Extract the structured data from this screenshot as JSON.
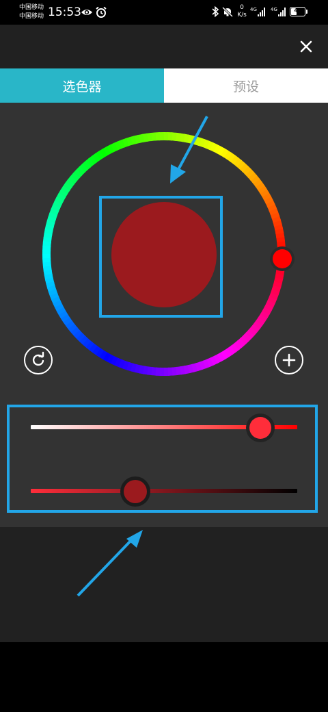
{
  "status_bar": {
    "carrier_1": "中国移动",
    "carrier_2": "中国移动",
    "time": "15:53",
    "speed_value": "0",
    "speed_unit": "K/s",
    "network_1": "4G",
    "network_2": "4G",
    "battery": "47",
    "icons": [
      "eye-icon",
      "alarm-icon",
      "bluetooth-icon",
      "mute-bell-icon",
      "signal-icon",
      "signal-icon",
      "battery-icon"
    ]
  },
  "header": {
    "close_icon": "close-icon"
  },
  "tabs": [
    {
      "label": "选色器",
      "active": true
    },
    {
      "label": "预设",
      "active": false
    }
  ],
  "color_picker": {
    "selected_color": "#9b1a1e",
    "hue_color": "#ff0000",
    "saturation_fraction": 0.86,
    "brightness_fraction": 0.39,
    "saturation_thumb_color": "#ff2d3a",
    "brightness_thumb_color": "#9b1a1e",
    "reset_icon": "refresh-icon",
    "add_icon": "plus-icon"
  },
  "colors": {
    "accent": "#29b6c8",
    "highlight": "#22a6e8"
  }
}
